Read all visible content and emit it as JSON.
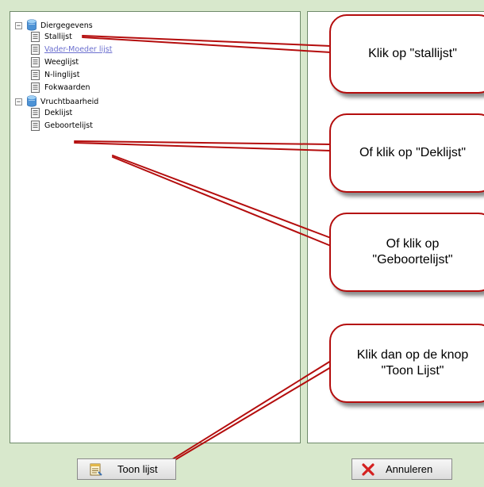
{
  "tree": {
    "groups": [
      {
        "label": "Diergegevens",
        "expander": "−",
        "items": [
          "Stallijst",
          "Vader-Moeder lijst",
          "Weeglijst",
          "N-linglijst",
          "Fokwaarden"
        ]
      },
      {
        "label": "Vruchtbaarheid",
        "expander": "−",
        "items": [
          "Deklijst",
          "Geboortelijst"
        ]
      }
    ]
  },
  "callouts": [
    "Klik op \"stallijst\"",
    "Of klik op \"Deklijst\"",
    "Of klik op\n\"Geboortelijst\"",
    "Klik dan op de knop\n\"Toon Lijst\""
  ],
  "buttons": {
    "toon_lijst": "Toon lijst",
    "annuleren": "Annuleren"
  },
  "colors": {
    "background": "#d8e8cc",
    "callout_border": "#b40d0d",
    "connector": "#b40d0d",
    "visited_link": "#6b6fcf"
  }
}
